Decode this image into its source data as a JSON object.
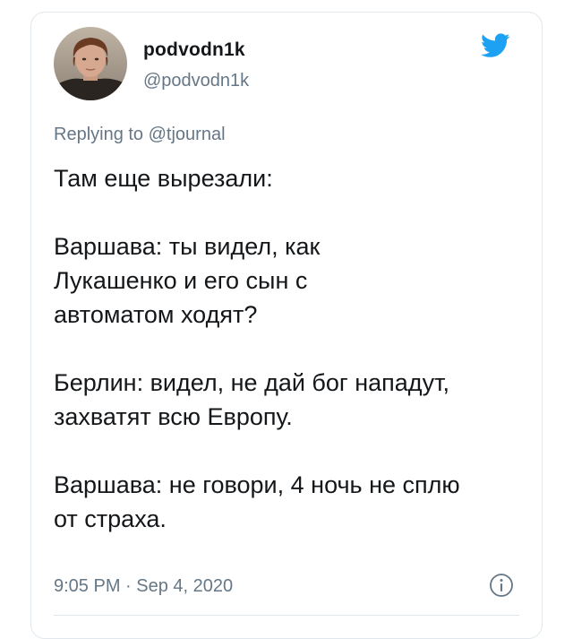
{
  "tweet": {
    "display_name": "podvodn1k",
    "handle": "@podvodn1k",
    "reply_prefix": "Replying to",
    "reply_mention": "@tjournal",
    "paragraphs": [
      "Там еще вырезали:",
      "Варшава: ты видел, как Лукашенко и его сын с автоматом ходят?",
      "Берлин: видел, не дай бог нападут, захватят всю Европу.",
      "Варшава: не говори, 4 ночь не сплю от страха."
    ],
    "timestamp": "9:05 PM · Sep 4, 2020"
  },
  "icons": {
    "logo": "twitter-bird-icon",
    "info": "info-icon",
    "avatar": "user-avatar"
  },
  "colors": {
    "twitter_blue": "#1da1f2",
    "secondary_text": "#657786",
    "primary_text": "#14171a"
  }
}
